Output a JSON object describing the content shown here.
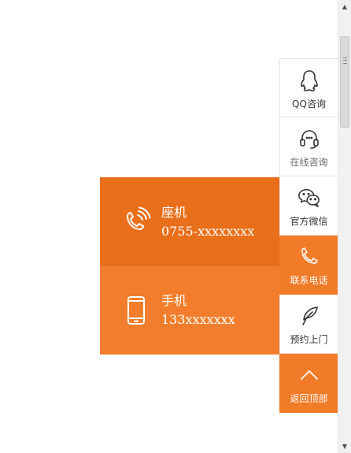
{
  "colors": {
    "accent": "#f27b28",
    "landline_bg": "#ea6f1b",
    "mobile_bg": "#f27e2d"
  },
  "side_bar": {
    "items": [
      {
        "label": "QQ咨询",
        "icon": "qq-icon"
      },
      {
        "label": "在线咨询",
        "icon": "headset-icon"
      },
      {
        "label": "官方微信",
        "icon": "wechat-icon"
      },
      {
        "label": "联系电话",
        "icon": "phone-icon"
      },
      {
        "label": "预约上门",
        "icon": "feather-icon"
      },
      {
        "label": "返回顶部",
        "icon": "chevron-up-icon"
      }
    ]
  },
  "contact_panel": {
    "landline": {
      "title": "座机",
      "number": "0755-xxxxxxxx",
      "icon": "telephone-ringing-icon"
    },
    "mobile": {
      "title": "手机",
      "number": "133xxxxxxx",
      "icon": "mobile-phone-icon"
    }
  }
}
